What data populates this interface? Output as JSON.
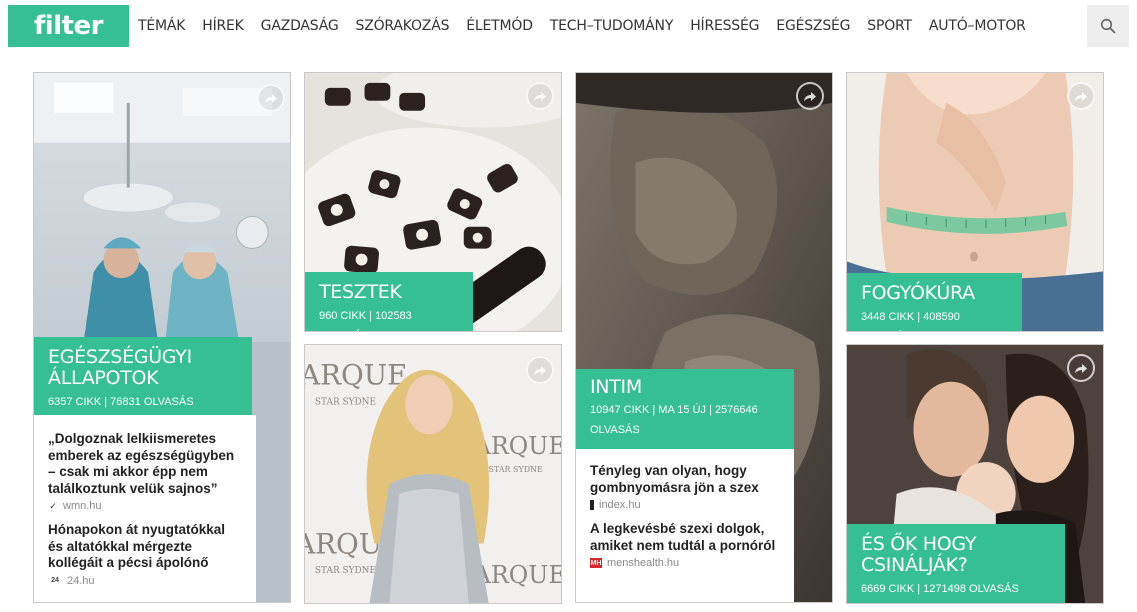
{
  "header": {
    "logo": "filter",
    "nav": [
      "TÉMÁK",
      "HÍREK",
      "GAZDASÁG",
      "SZÓRAKOZÁS",
      "ÉLETMÓD",
      "TECH–TUDOMÁNY",
      "HÍRESSÉG",
      "EGÉSZSÉG",
      "SPORT",
      "AUTÓ–MOTOR"
    ],
    "search_icon": "search-icon"
  },
  "colors": {
    "accent": "#37bf94"
  },
  "tiles": {
    "health": {
      "title": "EGÉSZSÉGÜGYI ÁLLAPOTOK",
      "stats": "6357 CIKK | 76831 OLVASÁS",
      "articles": [
        {
          "title": "„Dolgoznak lelkiismeretes emberek az egészségügyben – csak mi akkor épp nem találkoztunk velük sajnos”",
          "source": "wmn.hu"
        },
        {
          "title": "Hónapokon át nyugtatókkal és altatókkal mérgezte kollégáit a pécsi ápolónő",
          "source": "24.hu",
          "source_mark": "24"
        }
      ]
    },
    "tests": {
      "title": "TESZTEK",
      "stats": "960 CIKK | 102583 OLVASÁS"
    },
    "celebrity": {},
    "intim": {
      "title": "INTIM",
      "stats": "10947 CIKK | MA 15 ÚJ | 2576646 OLVASÁS",
      "articles": [
        {
          "title": "Tényleg van olyan, hogy gombnyomásra jön a szex",
          "source": "index.hu"
        },
        {
          "title": "A legkevésbé szexi dolgok, amiket nem tudtál a pornóról",
          "source": "menshealth.hu",
          "source_mark": "MH"
        }
      ]
    },
    "diet": {
      "title": "FOGYÓKÚRA",
      "stats": "3448 CIKK | 408590 OLVASÁS"
    },
    "couple": {
      "title": "ÉS ŐK HOGY CSINÁLJÁK?",
      "stats": "6669 CIKK | 1271498 OLVASÁS"
    }
  }
}
